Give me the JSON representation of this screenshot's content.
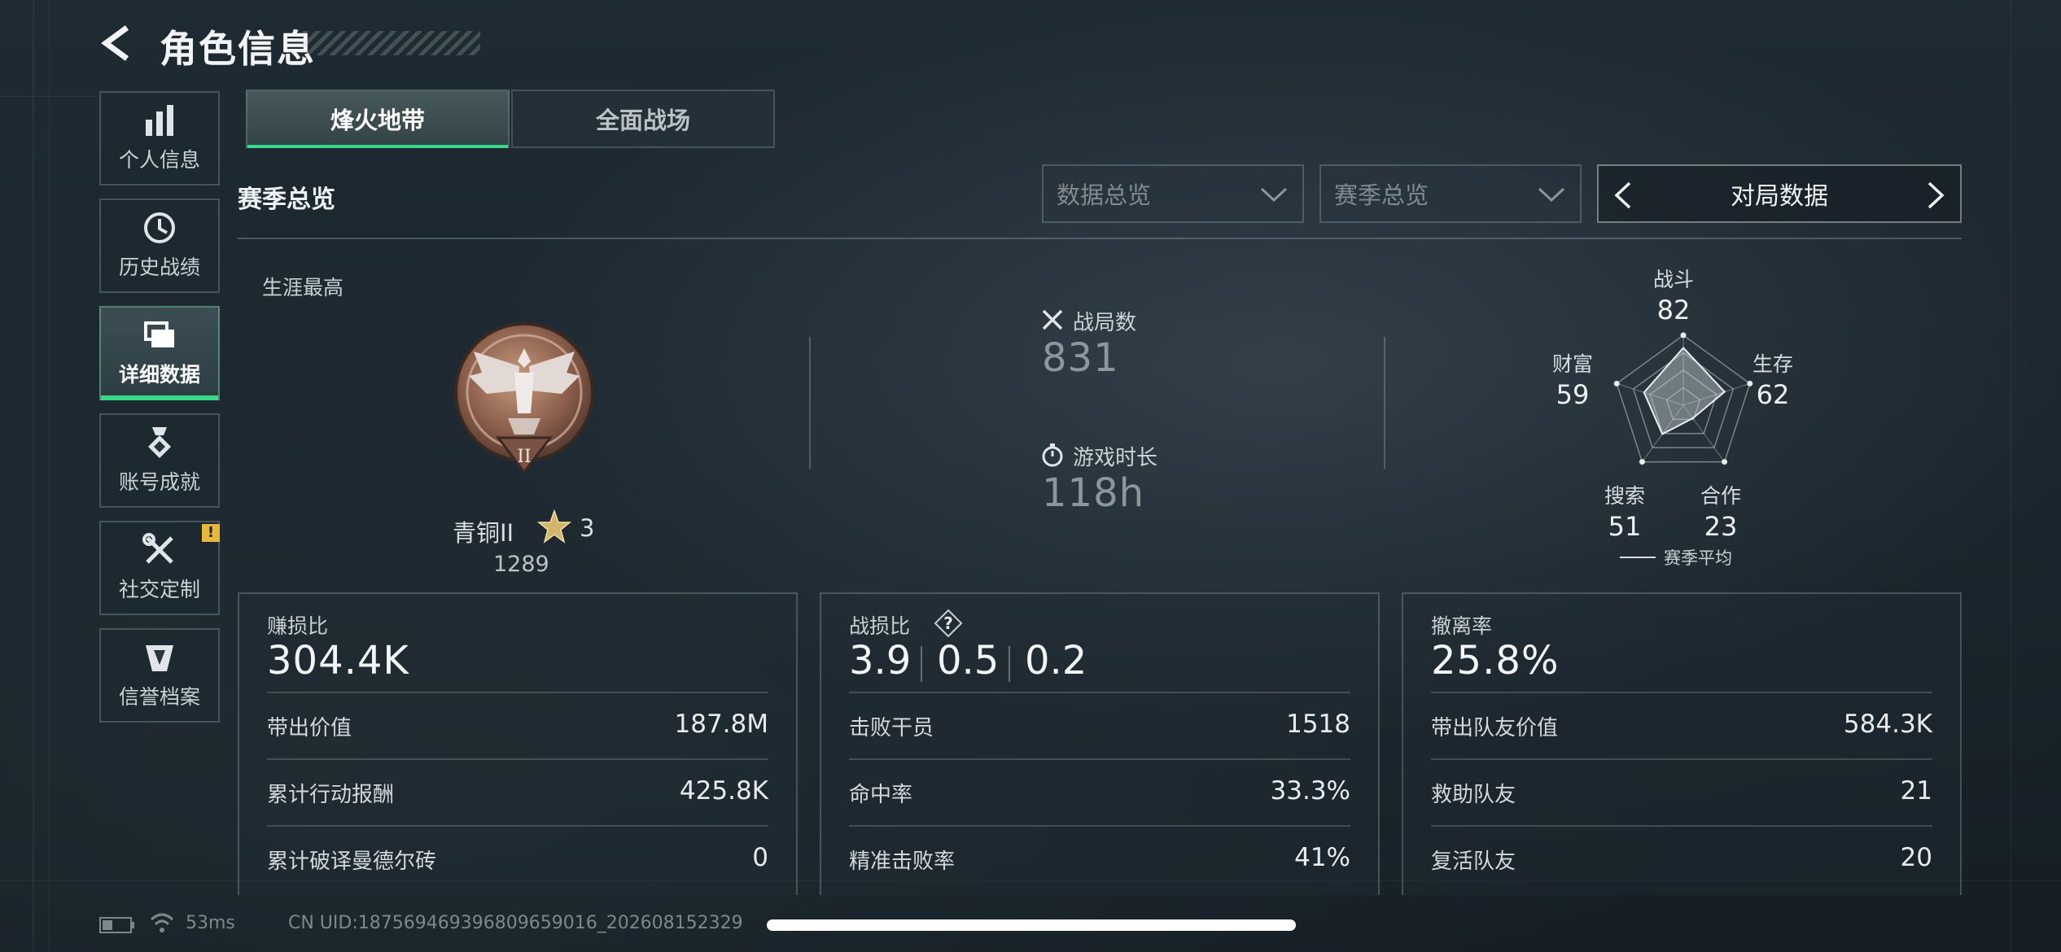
{
  "header": {
    "title": "角色信息"
  },
  "sidebar": {
    "items": [
      {
        "label": "个人信息",
        "icon": "bar-chart-icon",
        "active": false
      },
      {
        "label": "历史战绩",
        "icon": "history-clock-icon",
        "active": false
      },
      {
        "label": "详细数据",
        "icon": "folder-stack-icon",
        "active": true
      },
      {
        "label": "账号成就",
        "icon": "achievement-medal-icon",
        "active": false
      },
      {
        "label": "社交定制",
        "icon": "tools-icon",
        "active": false,
        "badge": "!"
      },
      {
        "label": "信誉档案",
        "icon": "credit-shield-icon",
        "active": false
      }
    ]
  },
  "tabs": [
    {
      "label": "烽火地带",
      "active": true
    },
    {
      "label": "全面战场",
      "active": false
    }
  ],
  "filters": {
    "section_title": "赛季总览",
    "dropdown_data": "数据总览",
    "dropdown_season": "赛季总览",
    "switcher_label": "对局数据"
  },
  "career": {
    "label": "生涯最高",
    "rank_name": "青铜II",
    "rank_numeral": "II",
    "rank_stars": "3",
    "rank_score": "1289"
  },
  "stats": {
    "matches_label": "战局数",
    "matches_value": "831",
    "playtime_label": "游戏时长",
    "playtime_value": "118h"
  },
  "radar": {
    "labels": {
      "combat": "战斗",
      "survival": "生存",
      "teamwork": "合作",
      "search": "搜索",
      "wealth": "财富"
    },
    "values": {
      "combat": "82",
      "survival": "62",
      "teamwork": "23",
      "search": "51",
      "wealth": "59"
    },
    "legend": "赛季平均"
  },
  "cards": {
    "profit": {
      "title": "赚损比",
      "value": "304.4K",
      "rows": [
        {
          "label": "带出价值",
          "value": "187.8M"
        },
        {
          "label": "累计行动报酬",
          "value": "425.8K"
        },
        {
          "label": "累计破译曼德尔砖",
          "value": "0"
        }
      ]
    },
    "kd": {
      "title": "战损比",
      "values": [
        "3.9",
        "0.5",
        "0.2"
      ],
      "rows": [
        {
          "label": "击败干员",
          "value": "1518"
        },
        {
          "label": "命中率",
          "value": "33.3%"
        },
        {
          "label": "精准击败率",
          "value": "41%"
        }
      ]
    },
    "extract": {
      "title": "撤离率",
      "value": "25.8%",
      "rows": [
        {
          "label": "带出队友价值",
          "value": "584.3K"
        },
        {
          "label": "救助队友",
          "value": "21"
        },
        {
          "label": "复活队友",
          "value": "20"
        }
      ]
    }
  },
  "footer": {
    "ping": "53ms",
    "uid": "CN UID:18756946939680965​9016_20260815232​9"
  }
}
